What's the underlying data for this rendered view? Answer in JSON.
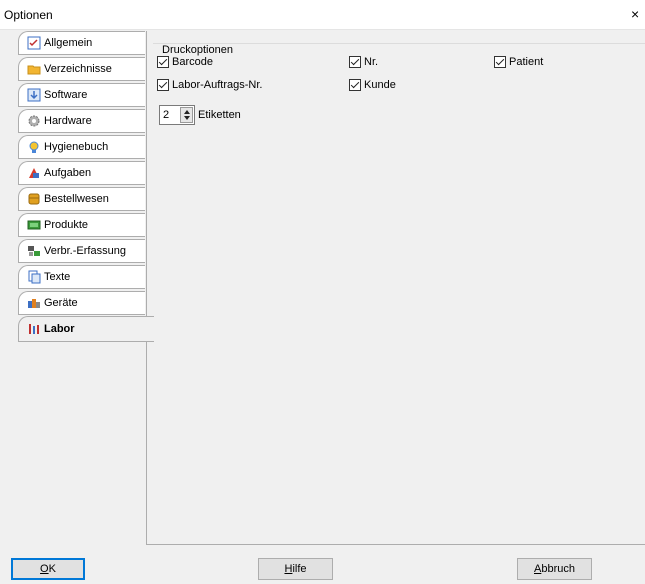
{
  "window": {
    "title": "Optionen",
    "close_glyph": "×"
  },
  "tabs": [
    {
      "label": "Allgemein",
      "icon": "checklist-icon",
      "color": "#3c6fc4",
      "active": false
    },
    {
      "label": "Verzeichnisse",
      "icon": "folder-icon",
      "color": "#f2b531",
      "active": false
    },
    {
      "label": "Software",
      "icon": "install-icon",
      "color": "#3c6fc4",
      "active": false
    },
    {
      "label": "Hardware",
      "icon": "gear-icon",
      "color": "#8a8a8a",
      "active": false
    },
    {
      "label": "Hygienebuch",
      "icon": "bulb-icon",
      "color": "#4a86d8",
      "active": false
    },
    {
      "label": "Aufgaben",
      "icon": "tasks-icon",
      "color": "#d83b2b",
      "active": false
    },
    {
      "label": "Bestellwesen",
      "icon": "package-icon",
      "color": "#e0a020",
      "active": false
    },
    {
      "label": "Produkte",
      "icon": "products-icon",
      "color": "#3a9a3a",
      "active": false
    },
    {
      "label": "Verbr.-Erfassung",
      "icon": "scanner-icon",
      "color": "#555555",
      "active": false
    },
    {
      "label": "Texte",
      "icon": "document-icon",
      "color": "#3c6fc4",
      "active": false
    },
    {
      "label": "Geräte",
      "icon": "devices-icon",
      "color": "#e08020",
      "active": false
    },
    {
      "label": "Labor",
      "icon": "lab-icon",
      "color": "#c03030",
      "active": true
    }
  ],
  "print_options": {
    "group_title": "Druckoptionen",
    "checkboxes": {
      "barcode": {
        "label": "Barcode",
        "checked": true
      },
      "nr": {
        "label": "Nr.",
        "checked": true
      },
      "patient": {
        "label": "Patient",
        "checked": true
      },
      "labor_auftrag": {
        "label": "Labor-Auftrags-Nr.",
        "checked": true
      },
      "kunde": {
        "label": "Kunde",
        "checked": true
      }
    },
    "labels_count": {
      "value": "2",
      "label": "Etiketten"
    }
  },
  "buttons": {
    "ok": {
      "mnemonic": "O",
      "rest": "K"
    },
    "help": {
      "mnemonic": "H",
      "rest": "ilfe"
    },
    "cancel": {
      "mnemonic": "A",
      "rest": "bbruch"
    }
  }
}
